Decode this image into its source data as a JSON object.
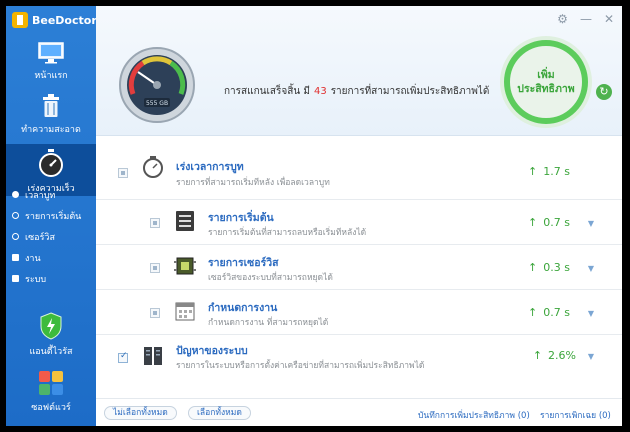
{
  "app": {
    "name": "BeeDoctor"
  },
  "sidebar": {
    "items": [
      {
        "label": "หน้าแรก",
        "icon": "monitor-icon"
      },
      {
        "label": "ทำความสะอาด",
        "icon": "trash-icon"
      },
      {
        "label": "เร่งความเร็ว",
        "icon": "stopwatch-icon"
      }
    ],
    "sub_items": [
      {
        "label": "เวลาบูท",
        "icon": "clock-icon"
      },
      {
        "label": "รายการเริ่มต้น",
        "icon": "startup-icon"
      },
      {
        "label": "เซอร์วิส",
        "icon": "services-icon"
      },
      {
        "label": "งาน",
        "icon": "tasks-icon"
      },
      {
        "label": "ระบบ",
        "icon": "system-icon"
      }
    ],
    "bottom_items": [
      {
        "label": "แอนตี้ไวรัส",
        "icon": "shield-icon"
      },
      {
        "label": "ซอฟต์แวร์",
        "icon": "software-icon"
      }
    ]
  },
  "header": {
    "gauge_label": "555 GB",
    "scan_prefix": "การสแกนเสร็จสิ้น มี",
    "scan_count": "43",
    "scan_suffix": "รายการที่สามารถเพิ่มประสิทธิภาพได้",
    "boost_label": "เพิ่มประสิทธิภาพ"
  },
  "rows": [
    {
      "title": "เร่งเวลาการบูท",
      "desc": "รายการที่สามารถเริ่มทีหลัง เพื่อลดเวลาบูท",
      "value": "1.7 s",
      "icon": "boot-timer-icon"
    },
    {
      "title": "รายการเริ่มต้น",
      "desc": "รายการเริ่มต้นที่สามารถลบหรือเริ่มทีหลังได้",
      "value": "0.7 s",
      "icon": "startup-list-icon"
    },
    {
      "title": "รายการเซอร์วิส",
      "desc": "เซอร์วิสของระบบที่สามารถหยุดได้",
      "value": "0.3 s",
      "icon": "chip-icon"
    },
    {
      "title": "กำหนดการงาน",
      "desc": "กำหนดการงาน ที่สามารถหยุดได้",
      "value": "0.7 s",
      "icon": "calendar-icon"
    },
    {
      "title": "ปัญหาของระบบ",
      "desc": "รายการในระบบหรือการตั้งค่าเครือข่ายที่สามารถเพิ่มประสิทธิภาพได้",
      "value": "2.6%",
      "icon": "server-icon"
    }
  ],
  "footer": {
    "deselect_all": "ไม่เลือกทั้งหมด",
    "select_all": "เลือกทั้งหมด",
    "log_link": "บันทึกการเพิ่มประสิทธิภาพ (0)",
    "ignore_link": "รายการเพิกเฉย (0)"
  },
  "colors": {
    "accent": "#2c7fd6",
    "success": "#3ba53b",
    "count": "#e03030"
  }
}
